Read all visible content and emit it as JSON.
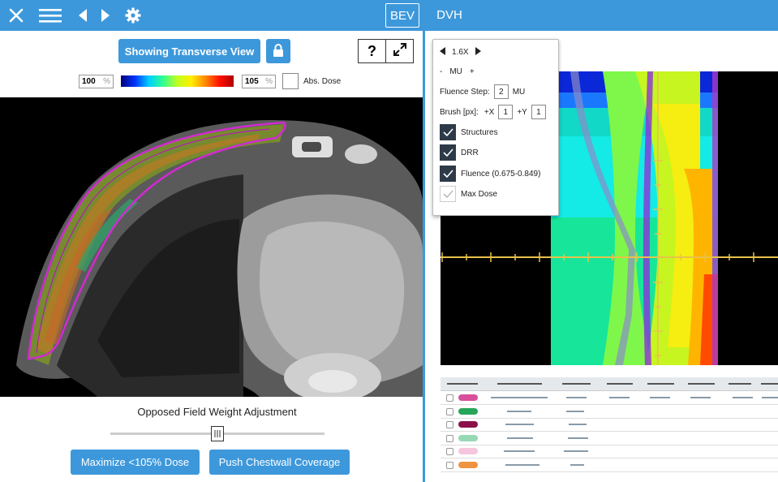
{
  "topbar": {
    "close_icon": "close-icon",
    "menu_icon": "menu-icon",
    "prev_icon": "triangle-left-icon",
    "next_icon": "triangle-right-icon",
    "settings_icon": "gear-icon",
    "tabs": [
      {
        "label": "BEV",
        "active": true
      },
      {
        "label": "DVH",
        "active": false
      }
    ]
  },
  "left_panel": {
    "view_button": "Showing Transverse View",
    "lock_icon": "lock-icon",
    "help_label": "?",
    "expand_icon": "expand-icon",
    "colorbar": {
      "min_value": "100",
      "max_value": "105",
      "unit": "%",
      "abs_dose_label": "Abs. Dose",
      "abs_dose_checked": false
    },
    "slider": {
      "title": "Opposed Field Weight Adjustment",
      "position_fraction": 0.5
    },
    "buttons": {
      "maximize": "Maximize <105% Dose",
      "push": "Push Chestwall Coverage"
    }
  },
  "popup": {
    "zoom": "1.6X",
    "mu_minus": "-",
    "mu_label": "MU",
    "mu_plus": "+",
    "fluence_step_label": "Fluence Step:",
    "fluence_step_value": "2",
    "fluence_step_unit": "MU",
    "brush_label": "Brush [px]:",
    "brush_x_label": "+X",
    "brush_x_value": "1",
    "brush_y_label": "+Y",
    "brush_y_value": "1",
    "options": [
      {
        "label": "Structures",
        "checked": true
      },
      {
        "label": "DRR",
        "checked": true
      },
      {
        "label": "Fluence (0.675-0.849)",
        "checked": true
      },
      {
        "label": "Max Dose",
        "checked": false
      }
    ]
  },
  "structure_table": {
    "rows": [
      {
        "color": "#d8509c"
      },
      {
        "color": "#27a559"
      },
      {
        "color": "#8b1049"
      },
      {
        "color": "#97d9b4"
      },
      {
        "color": "#f5c6dd"
      },
      {
        "color": "#ef9340"
      }
    ]
  }
}
